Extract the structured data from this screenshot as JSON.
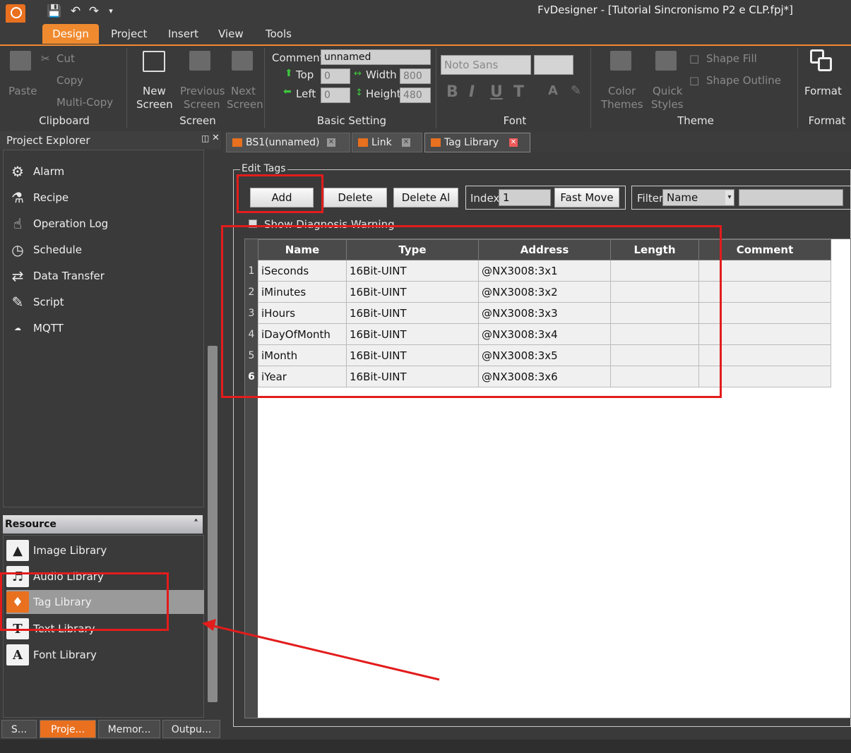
{
  "window": {
    "title": "FvDesigner - [Tutorial Sincronismo P2 e CLP.fpj*]"
  },
  "quick_access": {
    "save_icon": "save-icon",
    "undo_icon": "undo-icon",
    "redo_icon": "redo-icon",
    "dropdown_icon": "chevron-down-icon"
  },
  "menu": {
    "tabs": [
      "Design",
      "Project",
      "Insert",
      "View",
      "Tools"
    ],
    "active": "Design"
  },
  "ribbon": {
    "clipboard": {
      "paste": "Paste",
      "cut": "Cut",
      "copy": "Copy",
      "multi_copy": "Multi-Copy",
      "label": "Clipboard"
    },
    "screen": {
      "new_1": "New",
      "new_2": "Screen",
      "prev_1": "Previous",
      "prev_2": "Screen",
      "next_1": "Next",
      "next_2": "Screen",
      "label": "Screen"
    },
    "basic": {
      "comment_label": "Comment",
      "comment_value": "unnamed",
      "top_label": "Top",
      "top_value": "0",
      "left_label": "Left",
      "left_value": "0",
      "width_label": "Width",
      "width_value": "800",
      "height_label": "Height",
      "height_value": "480",
      "label": "Basic Setting"
    },
    "font": {
      "family": "Noto Sans",
      "bold": "B",
      "italic": "I",
      "underline": "U",
      "label": "Font"
    },
    "theme": {
      "color_1": "Color",
      "color_2": "Themes",
      "quick_1": "Quick",
      "quick_2": "Styles",
      "shape_fill": "Shape Fill",
      "shape_outline": "Shape Outline",
      "label": "Theme"
    },
    "format": {
      "button": "Format",
      "label": "Format"
    }
  },
  "project_explorer": {
    "title": "Project Explorer",
    "items": [
      {
        "label": "Alarm",
        "icon": "alarm-icon"
      },
      {
        "label": "Recipe",
        "icon": "flask-icon"
      },
      {
        "label": "Operation Log",
        "icon": "hand-icon"
      },
      {
        "label": "Schedule",
        "icon": "clock-icon"
      },
      {
        "label": "Data Transfer",
        "icon": "transfer-icon"
      },
      {
        "label": "Script",
        "icon": "script-icon"
      },
      {
        "label": "MQTT",
        "icon": "mqtt-icon"
      }
    ]
  },
  "resource": {
    "title": "Resource",
    "items": [
      {
        "label": "Image Library",
        "icon": "image-icon"
      },
      {
        "label": "Audio Library",
        "icon": "speaker-icon"
      },
      {
        "label": "Tag Library",
        "icon": "tag-icon"
      },
      {
        "label": "Text Library",
        "icon": "text-icon"
      },
      {
        "label": "Font Library",
        "icon": "font-icon"
      }
    ],
    "selected": "Tag Library"
  },
  "bottom_tabs": [
    "S...",
    "Proje...",
    "Memor...",
    "Outpu..."
  ],
  "doc_tabs": [
    "BS1(unnamed)",
    "Link",
    "Tag Library"
  ],
  "edit_tags": {
    "legend": "Edit Tags",
    "add": "Add",
    "delete": "Delete",
    "delete_all": "Delete Al",
    "index_label": "Index",
    "index_value": "1",
    "fast_move": "Fast Move",
    "filter_label": "Filter",
    "filter_field": "Name",
    "filter_value": "",
    "show_diag": "Show Diagnosis Warning"
  },
  "table": {
    "columns": [
      "Name",
      "Type",
      "Address",
      "Length",
      "Comment"
    ],
    "rows": [
      {
        "num": "1",
        "name": "iSeconds",
        "type": "16Bit-UINT",
        "address": "@NX3008:3x1",
        "length": "",
        "comment": ""
      },
      {
        "num": "2",
        "name": "iMinutes",
        "type": "16Bit-UINT",
        "address": "@NX3008:3x2",
        "length": "",
        "comment": ""
      },
      {
        "num": "3",
        "name": "iHours",
        "type": "16Bit-UINT",
        "address": "@NX3008:3x3",
        "length": "",
        "comment": ""
      },
      {
        "num": "4",
        "name": "iDayOfMonth",
        "type": "16Bit-UINT",
        "address": "@NX3008:3x4",
        "length": "",
        "comment": ""
      },
      {
        "num": "5",
        "name": "iMonth",
        "type": "16Bit-UINT",
        "address": "@NX3008:3x5",
        "length": "",
        "comment": ""
      },
      {
        "num": "6",
        "name": "iYear",
        "type": "16Bit-UINT",
        "address": "@NX3008:3x6",
        "length": "",
        "comment": ""
      }
    ]
  },
  "colors": {
    "accent": "#f08a2e",
    "annotation": "#e31c1c"
  }
}
